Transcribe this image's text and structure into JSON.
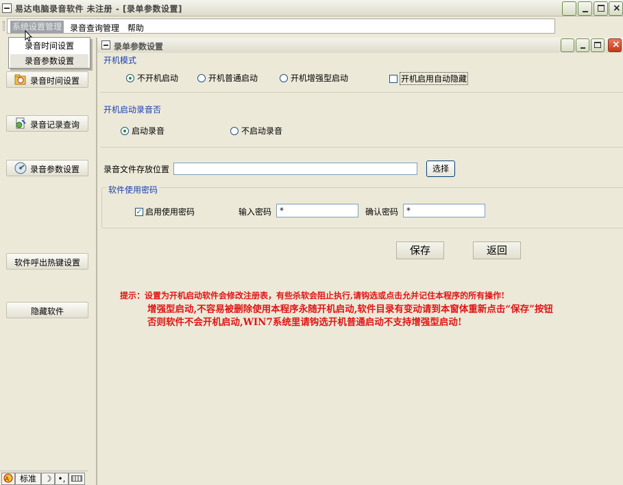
{
  "window": {
    "title": "易达电脑录音软件 未注册 - [录单参数设置]"
  },
  "menu": {
    "items": [
      "系统设置管理",
      "录音查询管理",
      "帮助"
    ],
    "dropdown": [
      "录音时间设置",
      "录音参数设置"
    ]
  },
  "sidebar": {
    "buttons": [
      "录音时间设置",
      "录音记录查询",
      "录音参数设置",
      "软件呼出热键设置",
      "隐藏软件"
    ]
  },
  "child": {
    "title": "录单参数设置",
    "boot_mode": {
      "label": "开机模式",
      "options": [
        "不开机启动",
        "开机普通启动",
        "开机增强型启动"
      ],
      "selected": 0,
      "auto_hide_label": "开机启用自动隐藏",
      "auto_hide_checked": false
    },
    "boot_record": {
      "label": "开机启动录音否",
      "options": [
        "启动录音",
        "不启动录音"
      ],
      "selected": 0
    },
    "storage": {
      "label": "录音文件存放位置",
      "value": "",
      "browse_button": "选择"
    },
    "password": {
      "group_label": "软件使用密码",
      "enable_label": "启用使用密码",
      "enable_checked": true,
      "input_label": "输入密码",
      "input_value": "*",
      "confirm_label": "确认密码",
      "confirm_value": "*"
    },
    "save_button": "保存",
    "back_button": "返回",
    "tips": {
      "line1": "提示：设置为开机启动软件会修改注册表，有些杀软会阻止执行,请钩选或点击允并记住本程序的所有操作!",
      "line2": "增强型启动,不容易被删除使用本程序永随开机启动,软件目录有变动请到本窗体重新点击“保存”按钮",
      "line3": "否则软件不会开机启动,WIN7系统里请钩选开机普通启动不支持增强型启动!"
    }
  },
  "ime": {
    "mode": "标准"
  }
}
